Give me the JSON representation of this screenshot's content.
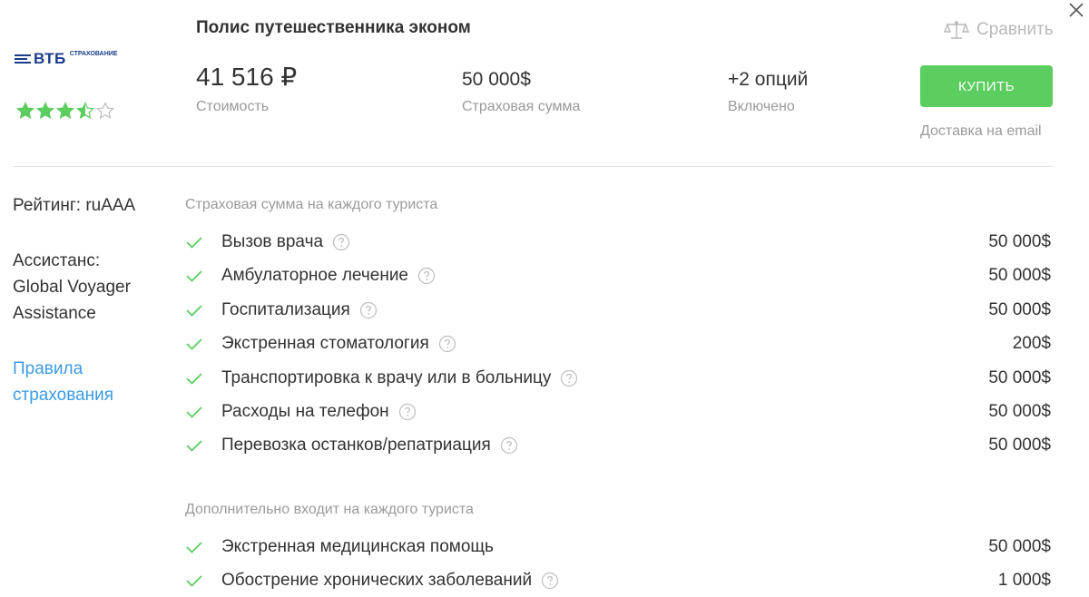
{
  "header": {
    "title": "Полис путешественника эконом",
    "compare_label": "Сравнить",
    "buy_label": "КУПИТЬ",
    "delivery": "Доставка на email"
  },
  "company": {
    "logo_text": "ВТБ",
    "logo_sub": "СТРАХОВАНИЕ",
    "rating_stars": 3.5,
    "rating_max": 5,
    "star_color": "#5ccd5f"
  },
  "metrics": {
    "cost_value": "41 516 ₽",
    "cost_label": "Стоимость",
    "sum_value": "50 000$",
    "sum_label": "Страховая сумма",
    "options_value": "+2 опций",
    "options_label": "Включено"
  },
  "sidebar": {
    "rating": "Рейтинг: ruAAA",
    "assistance_line1": "Ассистанс:",
    "assistance_line2": "Global Voyager",
    "assistance_line3": "Assistance",
    "rules_line1": "Правила",
    "rules_line2": "страхования"
  },
  "sections": {
    "coverage_title": "Страховая сумма на каждого туриста",
    "coverage": [
      {
        "name": "Вызов врача",
        "amount": "50 000$"
      },
      {
        "name": "Амбулаторное лечение",
        "amount": "50 000$"
      },
      {
        "name": "Госпитализация",
        "amount": "50 000$"
      },
      {
        "name": "Экстренная стоматология",
        "amount": "200$"
      },
      {
        "name": "Транспортировка к врачу или в больницу",
        "amount": "50 000$"
      },
      {
        "name": "Расходы на телефон",
        "amount": "50 000$"
      },
      {
        "name": "Перевозка останков/репатриация",
        "amount": "50 000$"
      }
    ],
    "extra_title": "Дополнительно входит на каждого туриста",
    "extra": [
      {
        "name": "Экстренная медицинская помощь",
        "amount": "50 000$"
      },
      {
        "name": "Обострение хронических заболеваний",
        "amount": "1 000$"
      }
    ]
  },
  "colors": {
    "accent_green": "#5ccd5f",
    "link_blue": "#3b9be8",
    "muted_text": "#9a9a9a"
  }
}
